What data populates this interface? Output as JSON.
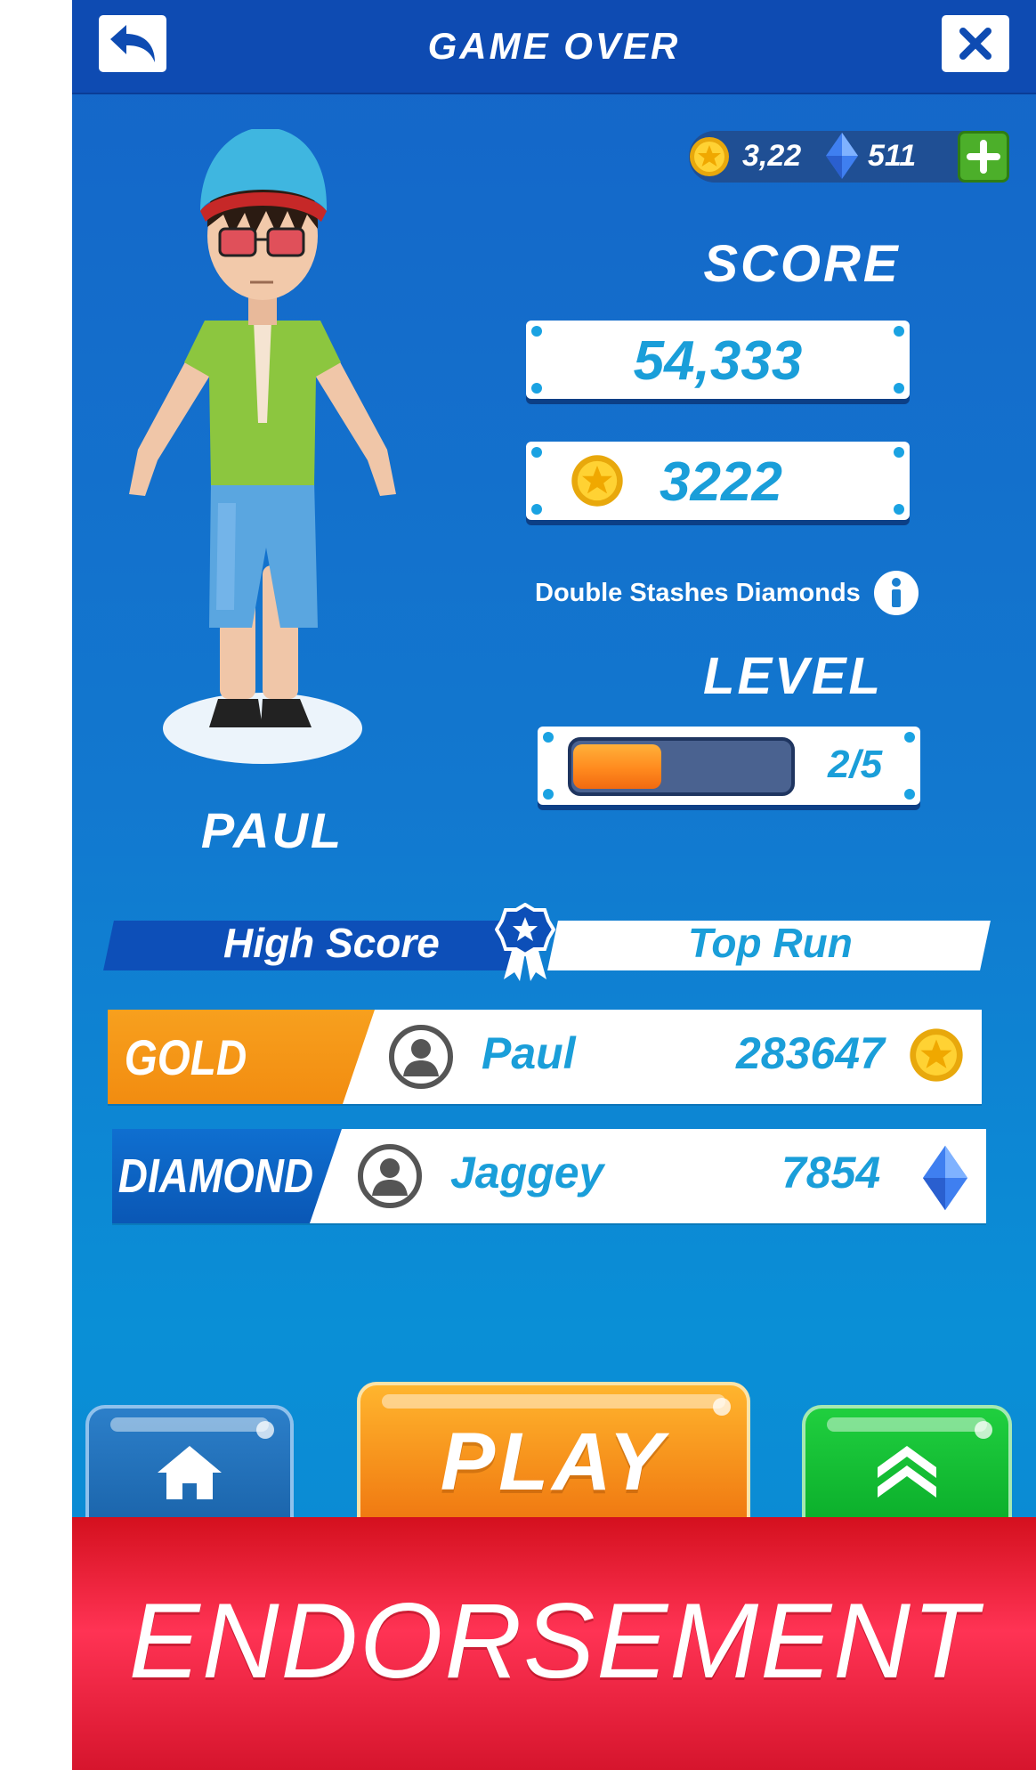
{
  "header": {
    "title": "GAME OVER",
    "back_icon": "back-arrow-icon",
    "close_icon": "close-icon"
  },
  "currency": {
    "coins": "3,22",
    "diamonds": "511",
    "coin_icon": "coin-icon",
    "diamond_icon": "diamond-icon",
    "add_icon": "plus-icon"
  },
  "character": {
    "name": "PAUL"
  },
  "results": {
    "score_heading": "SCORE",
    "score": "54,333",
    "coins": "3222",
    "bonus_text": "Double Stashes Diamonds",
    "level_heading": "LEVEL",
    "level_text": "2/5",
    "level_progress": 0.4
  },
  "leaderboard": {
    "tabs": [
      {
        "label": "High Score"
      },
      {
        "label": "Top Run"
      }
    ],
    "rows": [
      {
        "tier": "GOLD",
        "name": "Paul",
        "value": "283647",
        "icon": "coin-icon"
      },
      {
        "tier": "DIAMOND",
        "name": "Jaggey",
        "value": "7854",
        "icon": "diamond-icon"
      }
    ]
  },
  "buttons": {
    "play": "PLAY",
    "home_icon": "home-icon",
    "upgrade_icon": "chevron-up-icon"
  },
  "banner": {
    "text": "ENDORSEMENT"
  },
  "colors": {
    "header_blue": "#0e4bb2",
    "accent_cyan": "#1a9ed9",
    "gold_orange": "#f7a01e",
    "play_orange": "#f7941d",
    "upgrade_green": "#0cb02c",
    "banner_red": "#ff3354"
  }
}
